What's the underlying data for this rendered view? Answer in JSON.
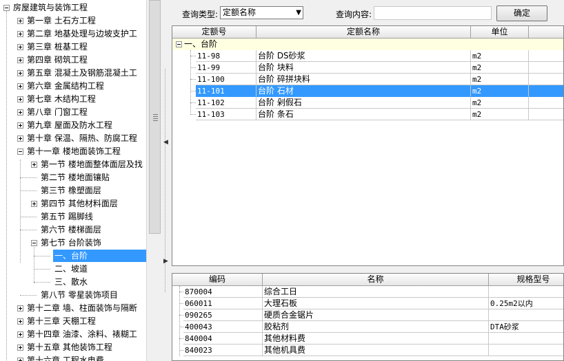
{
  "tree": {
    "nodes": [
      {
        "label": "房屋建筑与装饰工程",
        "state": "minus",
        "level": 0
      },
      {
        "label": "第一章 土石方工程",
        "state": "plus",
        "level": 1
      },
      {
        "label": "第二章 地基处理与边坡支护工",
        "state": "plus",
        "level": 1
      },
      {
        "label": "第三章 桩基工程",
        "state": "plus",
        "level": 1
      },
      {
        "label": "第四章 砌筑工程",
        "state": "plus",
        "level": 1
      },
      {
        "label": "第五章 混凝土及钢筋混凝土工",
        "state": "plus",
        "level": 1
      },
      {
        "label": "第六章 金属结构工程",
        "state": "plus",
        "level": 1
      },
      {
        "label": "第七章 木结构工程",
        "state": "plus",
        "level": 1
      },
      {
        "label": "第八章 门窗工程",
        "state": "plus",
        "level": 1
      },
      {
        "label": "第九章 屋面及防水工程",
        "state": "plus",
        "level": 1
      },
      {
        "label": "第十章 保温、隔热、防腐工程",
        "state": "plus",
        "level": 1
      },
      {
        "label": "第十一章 楼地面装饰工程",
        "state": "minus",
        "level": 1
      },
      {
        "label": "第一节 楼地面整体面层及找",
        "state": "plus",
        "level": 2
      },
      {
        "label": "第二节 楼地面镶贴",
        "state": "leaf",
        "level": 2
      },
      {
        "label": "第三节 橡塑面层",
        "state": "leaf",
        "level": 2
      },
      {
        "label": "第四节 其他材料面层",
        "state": "plus",
        "level": 2
      },
      {
        "label": "第五节 踢脚线",
        "state": "leaf",
        "level": 2
      },
      {
        "label": "第六节 楼梯面层",
        "state": "leaf",
        "level": 2
      },
      {
        "label": "第七节 台阶装饰",
        "state": "minus",
        "level": 2
      },
      {
        "label": "一、台阶",
        "state": "leaf",
        "level": 3,
        "selected": true
      },
      {
        "label": "二、坡道",
        "state": "leaf",
        "level": 3
      },
      {
        "label": "三、散水",
        "state": "leaf",
        "level": 3
      },
      {
        "label": "第八节 零星装饰项目",
        "state": "leaf",
        "level": 2
      },
      {
        "label": "第十二章 墙、柱面装饰与隔断",
        "state": "plus",
        "level": 1
      },
      {
        "label": "第十三章 天棚工程",
        "state": "plus",
        "level": 1
      },
      {
        "label": "第十四章 油漆、涂料、裱糊工",
        "state": "plus",
        "level": 1
      },
      {
        "label": "第十五章 其他装饰工程",
        "state": "plus",
        "level": 1
      },
      {
        "label": "第十六章 工程水电费",
        "state": "plus",
        "level": 1
      }
    ]
  },
  "query": {
    "type_label": "查询类型:",
    "type_value": "定额名称",
    "content_label": "查询内容:",
    "content_value": "",
    "confirm_label": "确定"
  },
  "quota_grid": {
    "headers": [
      "定额号",
      "定额名称",
      "单位",
      ""
    ],
    "group_label": "一、台阶",
    "rows": [
      {
        "code": "11-98",
        "name": "台阶 DS砂浆",
        "unit": "m2"
      },
      {
        "code": "11-99",
        "name": "台阶 块料",
        "unit": "m2"
      },
      {
        "code": "11-100",
        "name": "台阶 碎拼块料",
        "unit": "m2"
      },
      {
        "code": "11-101",
        "name": "台阶 石材",
        "unit": "m2",
        "selected": true
      },
      {
        "code": "11-102",
        "name": "台阶 剁假石",
        "unit": "m2"
      },
      {
        "code": "11-103",
        "name": "台阶 条石",
        "unit": "m2"
      }
    ]
  },
  "material_grid": {
    "headers": [
      "编码",
      "名称",
      "规格型号"
    ],
    "rows": [
      {
        "code": "870004",
        "name": "综合工日",
        "spec": ""
      },
      {
        "code": "060011",
        "name": "大理石板",
        "spec": "0.25m2以内"
      },
      {
        "code": "090265",
        "name": "硬质合金锯片",
        "spec": ""
      },
      {
        "code": "400043",
        "name": "胶粘剂",
        "spec": "DTA砂浆"
      },
      {
        "code": "840004",
        "name": "其他材料费",
        "spec": ""
      },
      {
        "code": "840023",
        "name": "其他机具费",
        "spec": ""
      }
    ]
  },
  "colors": {
    "selection": "#3399ff",
    "group_row": "#ffffe1"
  }
}
